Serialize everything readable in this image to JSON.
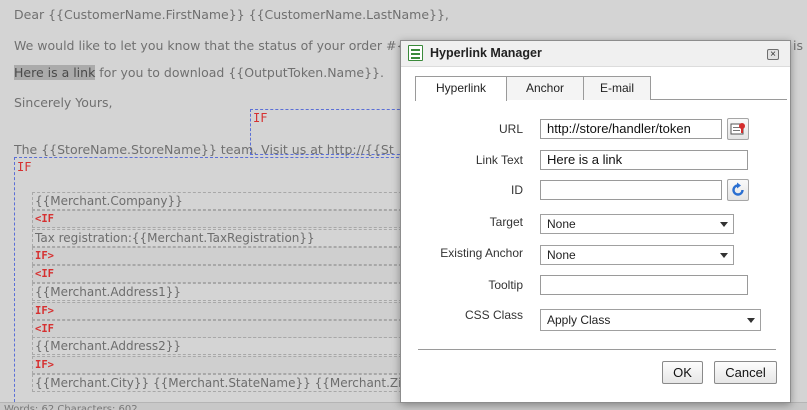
{
  "editor": {
    "greeting": "Dear {{CustomerName.FirstName}} {{CustomerName.LastName}},",
    "status_line": "We would like to let you know that the status of your order #{{",
    "status_tail": "is",
    "link_text": "Here is a link",
    "download_line": " for you to download {{OutputToken.Name}}.",
    "closing": "Sincerely Yours,",
    "if_label": "IF",
    "team_line": "The {{StoreName.StoreName}} team.    Visit us at http://{{St",
    "rows": [
      {
        "text": "{{Merchant.Company}}",
        "kind": "plain"
      },
      {
        "text": "<IF",
        "kind": "red"
      },
      {
        "text": "Tax registration:{{Merchant.TaxRegistration}}",
        "kind": "plain"
      },
      {
        "text": "IF>",
        "kind": "red"
      },
      {
        "text": "<IF",
        "kind": "red"
      },
      {
        "text": "{{Merchant.Address1}}",
        "kind": "plain"
      },
      {
        "text": "IF>",
        "kind": "red"
      },
      {
        "text": "<IF",
        "kind": "red"
      },
      {
        "text": "{{Merchant.Address2}}",
        "kind": "plain"
      },
      {
        "text": "IF>",
        "kind": "red"
      },
      {
        "text": "{{Merchant.City}} {{Merchant.StateName}} {{Merchant.Zi",
        "kind": "plain"
      }
    ],
    "statusbar": "Words: 62   Characters: 602"
  },
  "dialog": {
    "title": "Hyperlink Manager",
    "title_icon": "hyperlink-manager-icon",
    "close_icon": "close-icon",
    "tabs": [
      "Hyperlink",
      "Anchor",
      "E-mail"
    ],
    "active_tab": "Hyperlink",
    "fields": {
      "url_label": "URL",
      "url_value": "http://store/handler/token",
      "link_text_label": "Link Text",
      "link_text_value": "Here is a link",
      "id_label": "ID",
      "id_value": "",
      "target_label": "Target",
      "target_value": "None",
      "anchor_label": "Existing Anchor",
      "anchor_value": "None",
      "tooltip_label": "Tooltip",
      "tooltip_value": "",
      "css_label": "CSS Class",
      "css_value": "Apply Class"
    },
    "buttons": {
      "ok": "OK",
      "cancel": "Cancel"
    },
    "icons": {
      "url_browse": "document-manager-icon",
      "id_refresh": "refresh-icon"
    },
    "colors": {
      "refresh_blue": "#2a6fd1",
      "if_red": "#d63030",
      "dashed_blue": "#5b6fd6"
    }
  }
}
